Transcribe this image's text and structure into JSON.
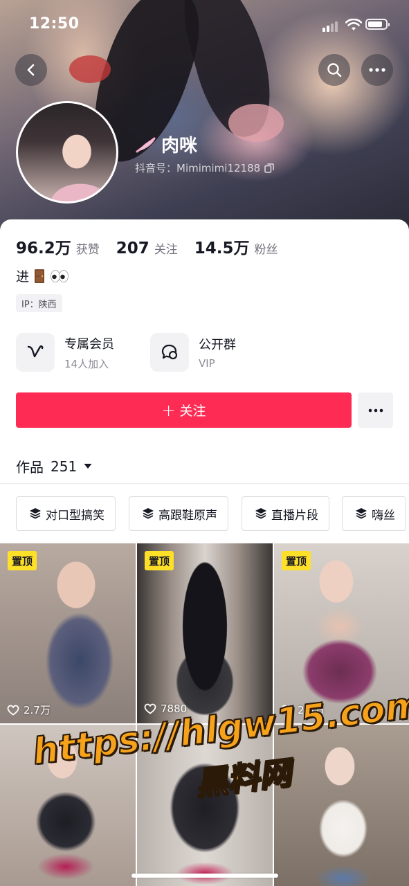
{
  "status_bar": {
    "time": "12:50",
    "battery_level": 0.85
  },
  "header": {
    "nickname": "肉咪",
    "douyin_id_label": "抖音号：",
    "douyin_id": "Mimimimi12188"
  },
  "stats": [
    {
      "value": "96.2万",
      "label": "获赞"
    },
    {
      "value": "207",
      "label": "关注"
    },
    {
      "value": "14.5万",
      "label": "粉丝"
    }
  ],
  "bio": {
    "text": "进"
  },
  "ip_tag": "IP：陕西",
  "features": [
    {
      "title": "专属会员",
      "subtitle": "14人加入",
      "icon": "v-member-icon"
    },
    {
      "title": "公开群",
      "subtitle": "VIP",
      "icon": "group-chat-icon"
    }
  ],
  "follow_button": {
    "plus": "+",
    "label": "关注",
    "color": "#fe2c55"
  },
  "works_tab": {
    "label": "作品",
    "count": "251"
  },
  "collections": [
    {
      "label": "对口型搞笑"
    },
    {
      "label": "高跟鞋原声"
    },
    {
      "label": "直播片段"
    },
    {
      "label": "嗨丝"
    }
  ],
  "videos": [
    {
      "pinned": "置顶",
      "likes": "2.7万"
    },
    {
      "pinned": "置顶",
      "likes": "7880"
    },
    {
      "pinned": "置顶",
      "likes": "2.5万"
    },
    {
      "pinned": "",
      "likes": ""
    },
    {
      "pinned": "",
      "likes": ""
    },
    {
      "pinned": "",
      "likes": ""
    }
  ],
  "watermark": {
    "line1": "https://hlgw15.com",
    "line2": "黑料网"
  },
  "colors": {
    "accent": "#fe2c55",
    "pin_badge": "#fee029",
    "watermark": "#f7a21b"
  }
}
